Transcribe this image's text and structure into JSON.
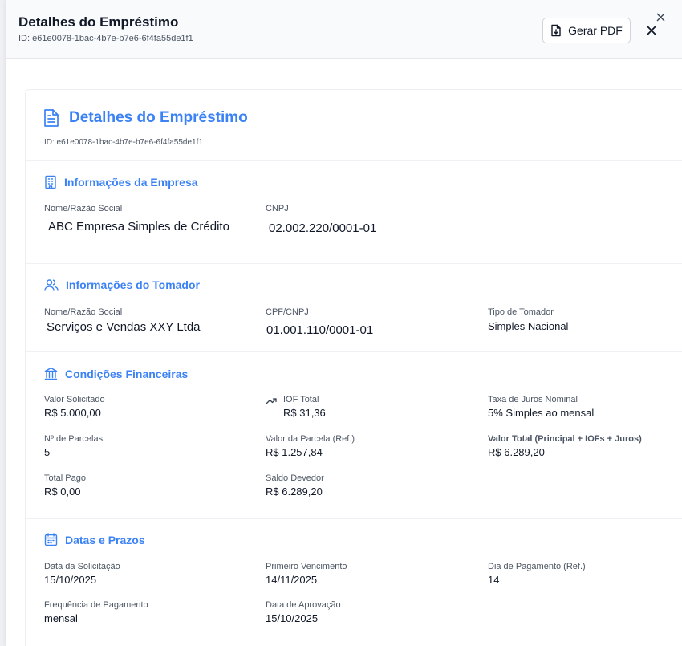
{
  "header": {
    "title": "Detalhes do Empréstimo",
    "id_text": "ID: e61e0078-1bac-4b7e-b7e6-6f4fa55de1f1",
    "pdf_button": "Gerar PDF"
  },
  "card": {
    "title": "Detalhes do Empréstimo",
    "id_text": "ID: e61e0078-1bac-4b7e-b7e6-6f4fa55de1f1"
  },
  "empresa": {
    "title": "Informações da Empresa",
    "name_label": "Nome/Razão Social",
    "name_value": "ABC Empresa Simples de Crédito",
    "cnpj_label": "CNPJ",
    "cnpj_value": "02.002.220/0001-01"
  },
  "tomador": {
    "title": "Informações do Tomador",
    "name_label": "Nome/Razão Social",
    "name_value": "Serviços e Vendas XXY Ltda",
    "doc_label": "CPF/CNPJ",
    "doc_value": "01.001.110/0001-01",
    "type_label": "Tipo de Tomador",
    "type_value": "Simples Nacional"
  },
  "financeiras": {
    "title": "Condições Financeiras",
    "valor_solicitado_label": "Valor Solicitado",
    "valor_solicitado_value": "R$ 5.000,00",
    "iof_label": "IOF Total",
    "iof_value": "R$ 31,36",
    "taxa_label": "Taxa de Juros Nominal",
    "taxa_value": "5% Simples ao mensal",
    "parcelas_label": "Nº de Parcelas",
    "parcelas_value": "5",
    "valor_parcela_label": "Valor da Parcela (Ref.)",
    "valor_parcela_value": "R$ 1.257,84",
    "valor_total_label": "Valor Total (Principal + IOFs + Juros)",
    "valor_total_value": "R$ 6.289,20",
    "total_pago_label": "Total Pago",
    "total_pago_value": "R$ 0,00",
    "saldo_label": "Saldo Devedor",
    "saldo_value": "R$ 6.289,20"
  },
  "prazos": {
    "title": "Datas e Prazos",
    "solicitacao_label": "Data da Solicitação",
    "solicitacao_value": "15/10/2025",
    "vencimento_label": "Primeiro Vencimento",
    "vencimento_value": "14/11/2025",
    "dia_label": "Dia de Pagamento (Ref.)",
    "dia_value": "14",
    "frequencia_label": "Frequência de Pagamento",
    "frequencia_value": "mensal",
    "aprovacao_label": "Data de Aprovação",
    "aprovacao_value": "15/10/2025"
  },
  "colors": {
    "accent": "#3b82f6",
    "text": "#111827",
    "muted": "#4b5563"
  },
  "icons": {
    "pdf": "file-download-icon",
    "close": "close-icon",
    "document": "document-icon",
    "empresa": "building-icon",
    "tomador": "users-icon",
    "financeiras": "bank-icon",
    "iof": "trending-up-icon",
    "prazos": "calendar-icon"
  }
}
